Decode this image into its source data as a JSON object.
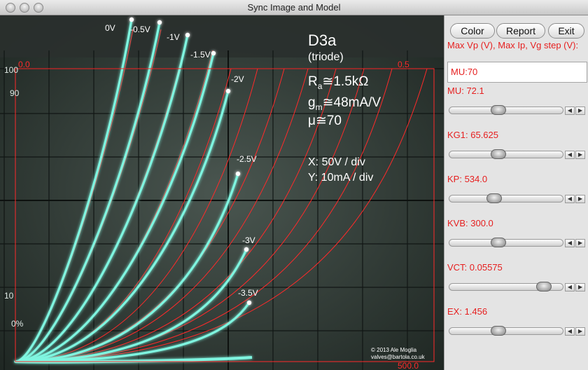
{
  "window": {
    "title": "Sync Image and Model"
  },
  "scope": {
    "tube_name": "D3a",
    "tube_type": "(triode)",
    "ra": "R",
    "ra_sub": "a",
    "ra_val": "≅1.5kΩ",
    "gm": "g",
    "gm_sub": "m",
    "gm_val": "≅48mA/V",
    "mu": "μ≅70",
    "x_scale": "X: 50V / div",
    "y_scale": "Y: 10mA / div",
    "credit_line1": "© 2013 Ale Moglia",
    "credit_line2": "valves@bartola.co.uk",
    "scope_left_100": "100",
    "scope_left_90": "90",
    "scope_left_10": "10",
    "scope_left_0": "0%",
    "overlay_top_left": "0.0",
    "overlay_top_right": "0.5",
    "overlay_bottom_right": "500.0",
    "grid_labels": [
      {
        "text": "0V"
      },
      {
        "text": "-0.5V"
      },
      {
        "text": "-1V"
      },
      {
        "text": "-1.5V"
      },
      {
        "text": "-2V"
      },
      {
        "text": "-2.5V"
      },
      {
        "text": "-3V"
      },
      {
        "text": "-3.5V"
      }
    ]
  },
  "buttons": {
    "color": "Color",
    "report": "Report",
    "exit": "Exit"
  },
  "panel": {
    "max_label": "Max Vp (V), Max Ip, Vg step (V):",
    "input_value": "MU:70",
    "params": [
      {
        "label": "MU: 72.1",
        "value": 0.42
      },
      {
        "label": "KG1: 65.625",
        "value": 0.42
      },
      {
        "label": "KP: 534.0",
        "value": 0.38
      },
      {
        "label": "KVB: 300.0",
        "value": 0.42
      },
      {
        "label": "VCT: 0.05575",
        "value": 0.88
      },
      {
        "label": "EX: 1.456",
        "value": 0.42
      }
    ]
  },
  "colors": {
    "trace": "#7ff5e0",
    "model": "#ff2a2a",
    "label": "#e62020"
  }
}
